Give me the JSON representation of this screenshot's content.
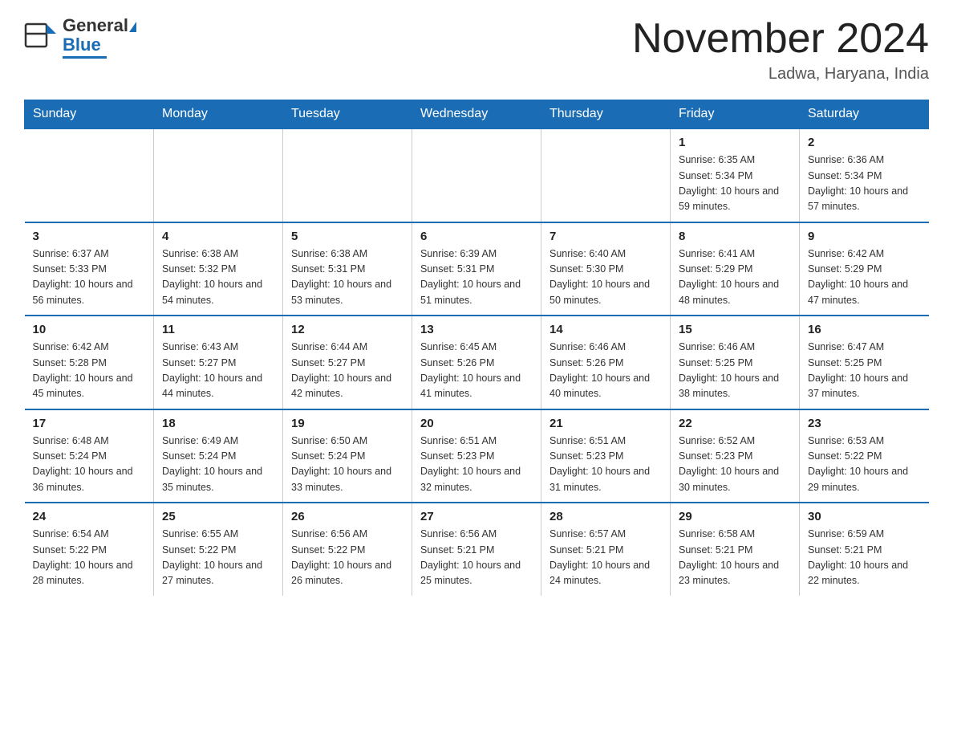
{
  "header": {
    "logo_general": "General",
    "logo_blue": "Blue",
    "month_title": "November 2024",
    "location": "Ladwa, Haryana, India"
  },
  "days_of_week": [
    "Sunday",
    "Monday",
    "Tuesday",
    "Wednesday",
    "Thursday",
    "Friday",
    "Saturday"
  ],
  "weeks": [
    [
      {
        "day": "",
        "info": ""
      },
      {
        "day": "",
        "info": ""
      },
      {
        "day": "",
        "info": ""
      },
      {
        "day": "",
        "info": ""
      },
      {
        "day": "",
        "info": ""
      },
      {
        "day": "1",
        "info": "Sunrise: 6:35 AM\nSunset: 5:34 PM\nDaylight: 10 hours and 59 minutes."
      },
      {
        "day": "2",
        "info": "Sunrise: 6:36 AM\nSunset: 5:34 PM\nDaylight: 10 hours and 57 minutes."
      }
    ],
    [
      {
        "day": "3",
        "info": "Sunrise: 6:37 AM\nSunset: 5:33 PM\nDaylight: 10 hours and 56 minutes."
      },
      {
        "day": "4",
        "info": "Sunrise: 6:38 AM\nSunset: 5:32 PM\nDaylight: 10 hours and 54 minutes."
      },
      {
        "day": "5",
        "info": "Sunrise: 6:38 AM\nSunset: 5:31 PM\nDaylight: 10 hours and 53 minutes."
      },
      {
        "day": "6",
        "info": "Sunrise: 6:39 AM\nSunset: 5:31 PM\nDaylight: 10 hours and 51 minutes."
      },
      {
        "day": "7",
        "info": "Sunrise: 6:40 AM\nSunset: 5:30 PM\nDaylight: 10 hours and 50 minutes."
      },
      {
        "day": "8",
        "info": "Sunrise: 6:41 AM\nSunset: 5:29 PM\nDaylight: 10 hours and 48 minutes."
      },
      {
        "day": "9",
        "info": "Sunrise: 6:42 AM\nSunset: 5:29 PM\nDaylight: 10 hours and 47 minutes."
      }
    ],
    [
      {
        "day": "10",
        "info": "Sunrise: 6:42 AM\nSunset: 5:28 PM\nDaylight: 10 hours and 45 minutes."
      },
      {
        "day": "11",
        "info": "Sunrise: 6:43 AM\nSunset: 5:27 PM\nDaylight: 10 hours and 44 minutes."
      },
      {
        "day": "12",
        "info": "Sunrise: 6:44 AM\nSunset: 5:27 PM\nDaylight: 10 hours and 42 minutes."
      },
      {
        "day": "13",
        "info": "Sunrise: 6:45 AM\nSunset: 5:26 PM\nDaylight: 10 hours and 41 minutes."
      },
      {
        "day": "14",
        "info": "Sunrise: 6:46 AM\nSunset: 5:26 PM\nDaylight: 10 hours and 40 minutes."
      },
      {
        "day": "15",
        "info": "Sunrise: 6:46 AM\nSunset: 5:25 PM\nDaylight: 10 hours and 38 minutes."
      },
      {
        "day": "16",
        "info": "Sunrise: 6:47 AM\nSunset: 5:25 PM\nDaylight: 10 hours and 37 minutes."
      }
    ],
    [
      {
        "day": "17",
        "info": "Sunrise: 6:48 AM\nSunset: 5:24 PM\nDaylight: 10 hours and 36 minutes."
      },
      {
        "day": "18",
        "info": "Sunrise: 6:49 AM\nSunset: 5:24 PM\nDaylight: 10 hours and 35 minutes."
      },
      {
        "day": "19",
        "info": "Sunrise: 6:50 AM\nSunset: 5:24 PM\nDaylight: 10 hours and 33 minutes."
      },
      {
        "day": "20",
        "info": "Sunrise: 6:51 AM\nSunset: 5:23 PM\nDaylight: 10 hours and 32 minutes."
      },
      {
        "day": "21",
        "info": "Sunrise: 6:51 AM\nSunset: 5:23 PM\nDaylight: 10 hours and 31 minutes."
      },
      {
        "day": "22",
        "info": "Sunrise: 6:52 AM\nSunset: 5:23 PM\nDaylight: 10 hours and 30 minutes."
      },
      {
        "day": "23",
        "info": "Sunrise: 6:53 AM\nSunset: 5:22 PM\nDaylight: 10 hours and 29 minutes."
      }
    ],
    [
      {
        "day": "24",
        "info": "Sunrise: 6:54 AM\nSunset: 5:22 PM\nDaylight: 10 hours and 28 minutes."
      },
      {
        "day": "25",
        "info": "Sunrise: 6:55 AM\nSunset: 5:22 PM\nDaylight: 10 hours and 27 minutes."
      },
      {
        "day": "26",
        "info": "Sunrise: 6:56 AM\nSunset: 5:22 PM\nDaylight: 10 hours and 26 minutes."
      },
      {
        "day": "27",
        "info": "Sunrise: 6:56 AM\nSunset: 5:21 PM\nDaylight: 10 hours and 25 minutes."
      },
      {
        "day": "28",
        "info": "Sunrise: 6:57 AM\nSunset: 5:21 PM\nDaylight: 10 hours and 24 minutes."
      },
      {
        "day": "29",
        "info": "Sunrise: 6:58 AM\nSunset: 5:21 PM\nDaylight: 10 hours and 23 minutes."
      },
      {
        "day": "30",
        "info": "Sunrise: 6:59 AM\nSunset: 5:21 PM\nDaylight: 10 hours and 22 minutes."
      }
    ]
  ]
}
